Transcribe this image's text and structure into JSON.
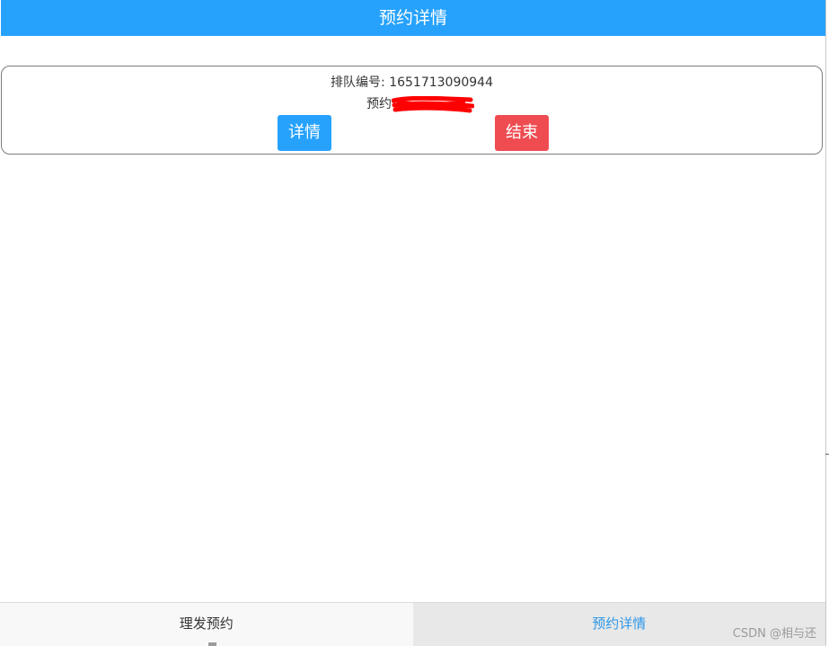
{
  "header": {
    "title": "预约详情"
  },
  "card": {
    "queue_label": "排队编号: ",
    "queue_number": "1651713090944",
    "appointment_label": "预约",
    "detail_button": "详情",
    "end_button": "结束"
  },
  "tabbar": {
    "tab_booking": "理发预约",
    "tab_details": "预约详情",
    "active_tab": "预约详情"
  },
  "watermark": "CSDN @相与还",
  "colors": {
    "header_bg": "#26a2fd",
    "detail_button_bg": "#26a2fd",
    "end_button_bg": "#ef4c51",
    "active_tab_text": "#2d97e8",
    "redaction": "#ff0000"
  }
}
